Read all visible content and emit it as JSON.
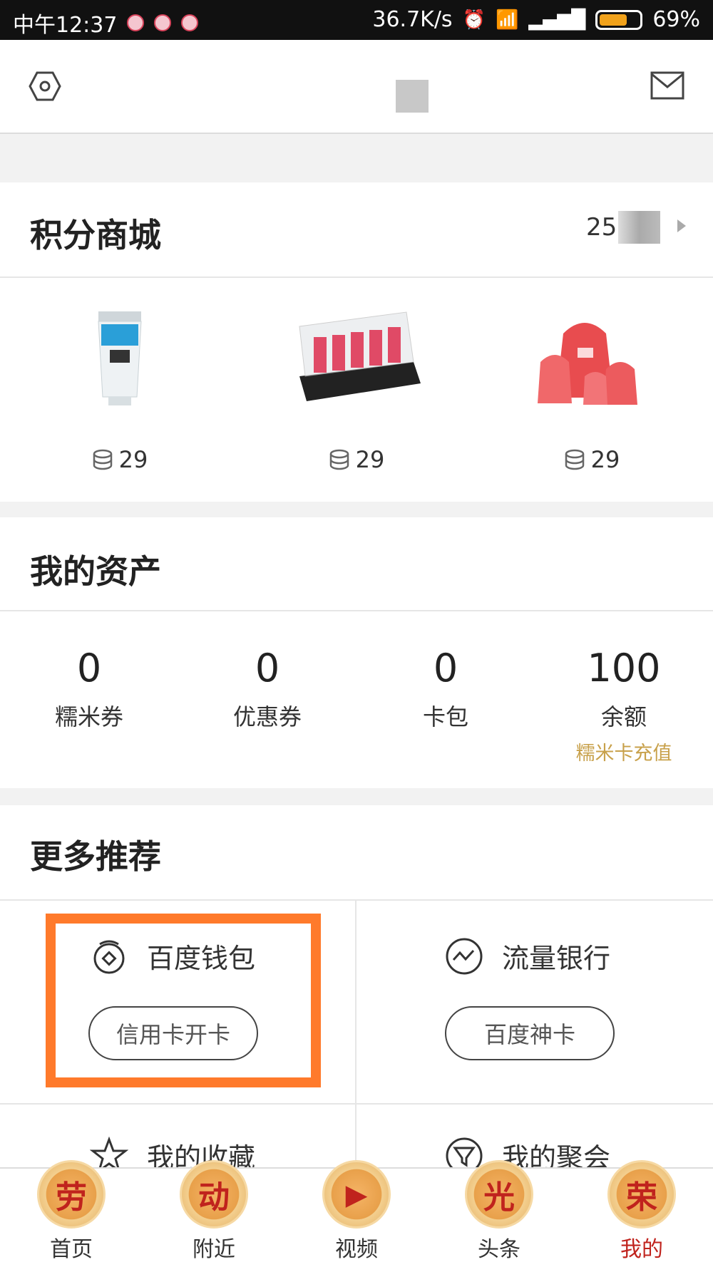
{
  "statusbar": {
    "time": "中午12:37",
    "speed": "36.7K/s",
    "battery": "69%",
    "battery_level": 0.69
  },
  "mall": {
    "title": "积分商城",
    "points_prefix": "25",
    "products": [
      {
        "name": "milk-cleanser-product",
        "price": "29"
      },
      {
        "name": "lipstick-set-product",
        "price": "29"
      },
      {
        "name": "drawstring-bags-product",
        "price": "29"
      }
    ]
  },
  "assets": {
    "title": "我的资产",
    "items": [
      {
        "value": "0",
        "label": "糯米券"
      },
      {
        "value": "0",
        "label": "优惠券"
      },
      {
        "value": "0",
        "label": "卡包"
      },
      {
        "value": "100",
        "label": "余额",
        "sub": "糯米卡充值"
      }
    ]
  },
  "reco": {
    "title": "更多推荐",
    "items": [
      {
        "label": "百度钱包",
        "button": "信用卡开卡"
      },
      {
        "label": "流量银行",
        "button": "百度神卡"
      },
      {
        "label": "我的收藏"
      },
      {
        "label": "我的聚会"
      }
    ]
  },
  "nav": {
    "items": [
      {
        "badge": "劳",
        "label": "首页"
      },
      {
        "badge": "动",
        "label": "附近"
      },
      {
        "badge": "▶",
        "label": "视频"
      },
      {
        "badge": "光",
        "label": "头条"
      },
      {
        "badge": "荣",
        "label": "我的"
      }
    ]
  },
  "colors": {
    "highlight": "#ff7a2b",
    "accent": "#c8a14b",
    "active": "#c0231d"
  }
}
